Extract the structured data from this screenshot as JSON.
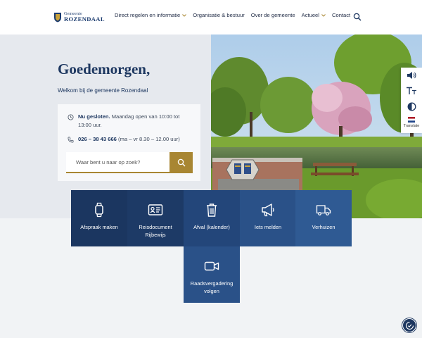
{
  "header": {
    "logo_small": "Gemeente",
    "logo_big": "ROZENDAAL",
    "nav": [
      {
        "label": "Direct regelen en informatie",
        "has_dropdown": true
      },
      {
        "label": "Organisatie & bestuur",
        "has_dropdown": false
      },
      {
        "label": "Over de gemeente",
        "has_dropdown": false
      },
      {
        "label": "Actueel",
        "has_dropdown": true
      },
      {
        "label": "Contact",
        "has_dropdown": false
      }
    ],
    "search_icon": "search-icon"
  },
  "hero": {
    "greeting": "Goedemorgen,",
    "welcome": "Welkom bij de gemeente Rozendaal",
    "status_strong": "Nu gesloten.",
    "status_text": " Maandag open van 10:00 tot 13:00 uur.",
    "phone_strong": "026 – 38 43 666",
    "phone_text": " (ma – vr 8.30 – 12.00 uur)",
    "search_placeholder": "Waar bent u naar op zoek?"
  },
  "tiles": [
    {
      "label": "Afspraak maken",
      "icon": "watch-icon",
      "color": "#1b3660"
    },
    {
      "label": "Reisdocument Rijbewijs",
      "icon": "id-card-icon",
      "color": "#1d3a66"
    },
    {
      "label": "Afval (kalender)",
      "icon": "trash-icon",
      "color": "#23467a"
    },
    {
      "label": "Iets melden",
      "icon": "megaphone-icon",
      "color": "#2a5188"
    },
    {
      "label": "Verhuizen",
      "icon": "truck-icon",
      "color": "#2f5a93"
    },
    {
      "label": "Raadsvergadering volgen",
      "icon": "video-icon",
      "color": "#2a5188"
    }
  ],
  "toolbar": {
    "translate_label": "Translate"
  },
  "colors": {
    "navy": "#1d3760",
    "gold": "#a88632",
    "hero_bg": "#e6e9ee"
  }
}
